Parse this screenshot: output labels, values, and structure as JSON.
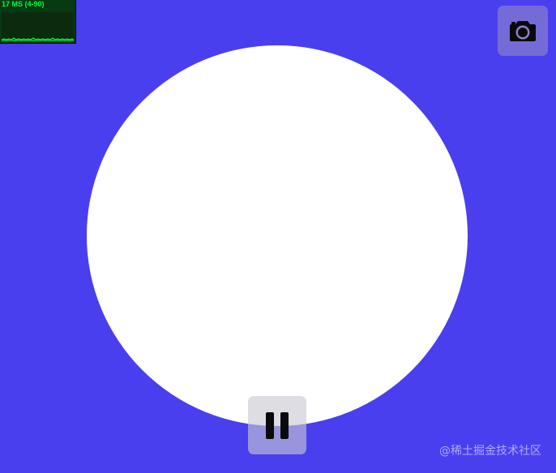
{
  "stats": {
    "label": "17 MS (4-90)",
    "graph_color": "#00ff44",
    "panel_color": "#063a12"
  },
  "canvas": {
    "background_color": "#4a3fef",
    "shape": "circle",
    "shape_color": "#ffffff"
  },
  "controls": {
    "camera_icon": "camera-icon",
    "pause_icon": "pause-icon"
  },
  "watermark": {
    "text": "@稀土掘金技术社区"
  }
}
